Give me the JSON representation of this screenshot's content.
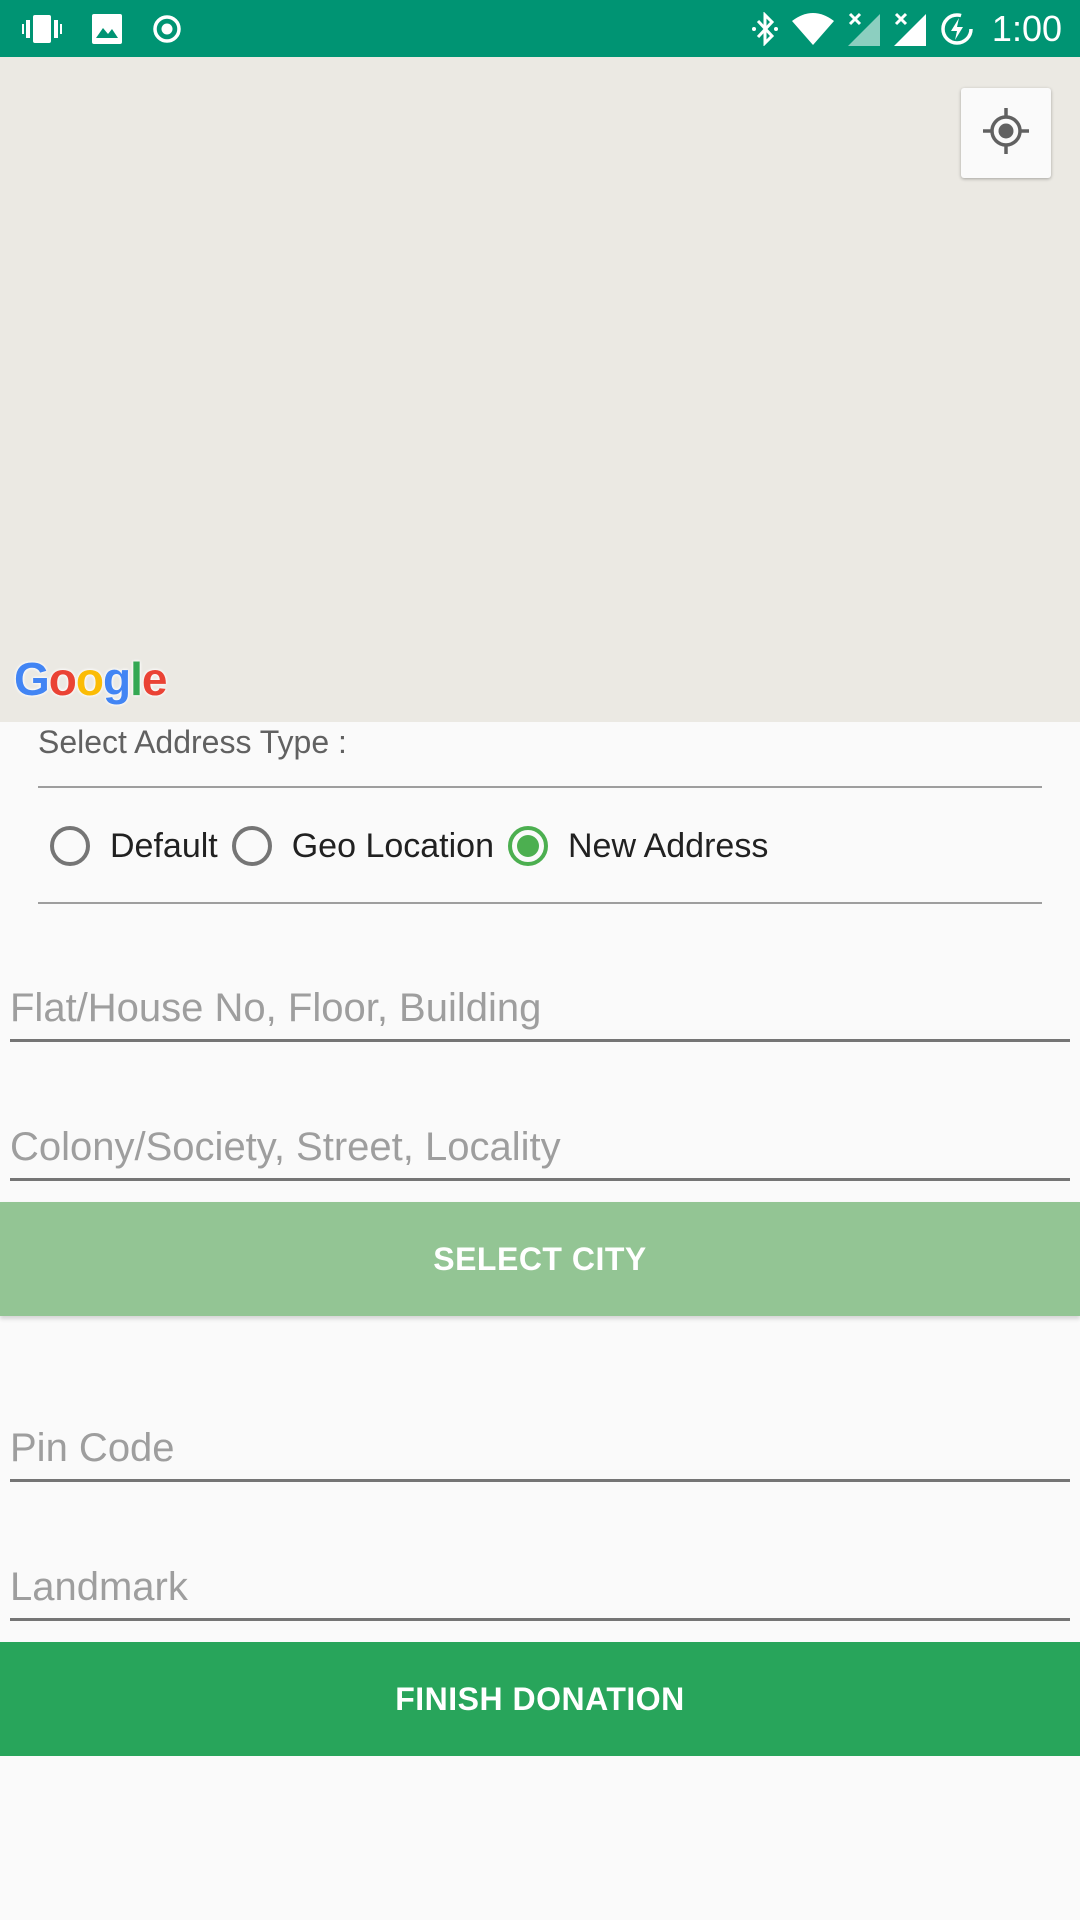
{
  "status_bar": {
    "time": "1:00",
    "left_icons": [
      "vibrate-icon",
      "image-icon",
      "record-icon"
    ],
    "right_icons": [
      "bluetooth-icon",
      "wifi-icon",
      "signal-icon",
      "signal-icon",
      "battery-charging-icon"
    ]
  },
  "map": {
    "logo_letters": [
      "G",
      "o",
      "o",
      "g",
      "l",
      "e"
    ],
    "logo_colors": [
      "#4285F4",
      "#EA4335",
      "#FBBC05",
      "#4285F4",
      "#34A853",
      "#EA4335"
    ]
  },
  "address_type": {
    "label": "Select Address Type :",
    "options": [
      {
        "label": "Default",
        "checked": false
      },
      {
        "label": "Geo Location",
        "checked": false
      },
      {
        "label": "New Address",
        "checked": true
      }
    ]
  },
  "fields": {
    "flat": {
      "placeholder": "Flat/House No, Floor, Building",
      "value": ""
    },
    "colony": {
      "placeholder": "Colony/Society, Street, Locality",
      "value": ""
    },
    "pin": {
      "placeholder": "Pin Code",
      "value": ""
    },
    "landmark": {
      "placeholder": "Landmark",
      "value": ""
    }
  },
  "buttons": {
    "select_city": "SELECT CITY",
    "finish": "FINISH DONATION"
  },
  "colors": {
    "status_bar": "#009473",
    "accent": "#4caf50",
    "select_city_bg": "#93c594",
    "finish_bg": "#28a55b"
  }
}
